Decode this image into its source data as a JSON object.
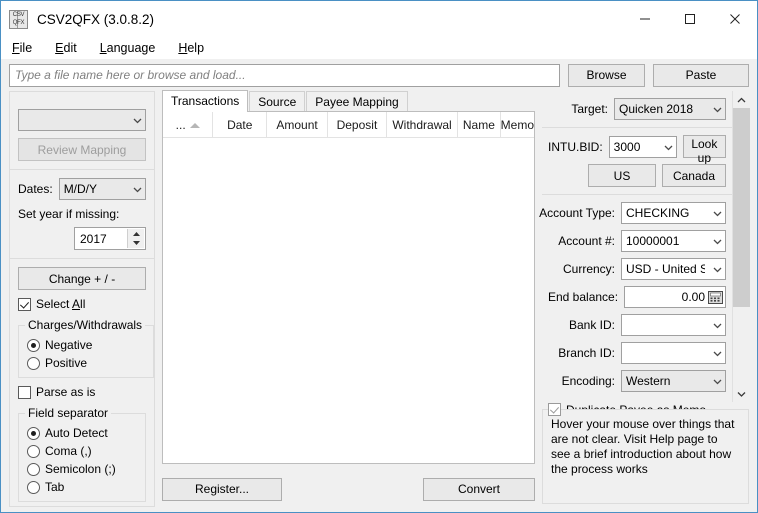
{
  "window": {
    "title": "CSV2QFX (3.0.8.2)",
    "icon_top": "CSV",
    "icon_bottom": "QFX",
    "minimize_label": "Minimize",
    "maximize_label": "Maximize",
    "close_label": "Close"
  },
  "menu": [
    {
      "label": "File",
      "accel": "F"
    },
    {
      "label": "Edit",
      "accel": "E"
    },
    {
      "label": "Language",
      "accel": "L"
    },
    {
      "label": "Help",
      "accel": "H"
    }
  ],
  "toolbar": {
    "file_placeholder": "Type a file name here or browse and load...",
    "file_value": "",
    "browse_label": "Browse",
    "paste_label": "Paste"
  },
  "left_panel": {
    "mapping_select_value": "",
    "review_mapping_label": "Review Mapping",
    "dates_label": "Dates:",
    "dates_value": "M/D/Y",
    "set_year_label": "Set year if missing:",
    "year_value": "2017",
    "change_sign_label": "Change + / -",
    "select_all_label": "Select All",
    "select_all_checked": true,
    "charges_group_label": "Charges/Withdrawals",
    "charges_options": [
      {
        "label": "Negative",
        "selected": true
      },
      {
        "label": "Positive",
        "selected": false
      }
    ],
    "parse_as_is_label": "Parse as is",
    "parse_as_is_checked": false,
    "separator_group_label": "Field separator",
    "separator_options": [
      {
        "label": "Auto Detect",
        "selected": true
      },
      {
        "label": "Coma (,)",
        "selected": false
      },
      {
        "label": "Semicolon (;)",
        "selected": false
      },
      {
        "label": "Tab",
        "selected": false
      }
    ]
  },
  "center_panel": {
    "tabs": [
      {
        "label": "Transactions",
        "active": true
      },
      {
        "label": "Source",
        "active": false
      },
      {
        "label": "Payee Mapping",
        "active": false
      }
    ],
    "columns": [
      {
        "label": "...",
        "sort": "asc"
      },
      {
        "label": "Date"
      },
      {
        "label": "Amount"
      },
      {
        "label": "Deposit"
      },
      {
        "label": "Withdrawal"
      },
      {
        "label": "Name"
      },
      {
        "label": "Memo"
      }
    ],
    "rows": [],
    "register_label": "Register...",
    "convert_label": "Convert"
  },
  "right_panel": {
    "target_label": "Target:",
    "target_value": "Quicken 2018",
    "intu_bid_label": "INTU.BID:",
    "intu_bid_value": "3000",
    "lookup_label": "Look up",
    "us_label": "US",
    "canada_label": "Canada",
    "account_type_label": "Account Type:",
    "account_type_value": "CHECKING",
    "account_num_label": "Account #:",
    "account_num_value": "10000001",
    "currency_label": "Currency:",
    "currency_value": "USD - United Sta",
    "end_balance_label": "End balance:",
    "end_balance_value": "0.00",
    "bank_id_label": "Bank ID:",
    "bank_id_value": "",
    "branch_id_label": "Branch ID:",
    "branch_id_value": "",
    "encoding_label": "Encoding:",
    "encoding_value": "Western",
    "duplicate_payee_label": "Duplicate Payee as Memo when missing",
    "duplicate_payee_checked": true,
    "hint_text": "Hover your mouse over things that are not clear. Visit Help page to see a brief introduction about how the process works"
  }
}
